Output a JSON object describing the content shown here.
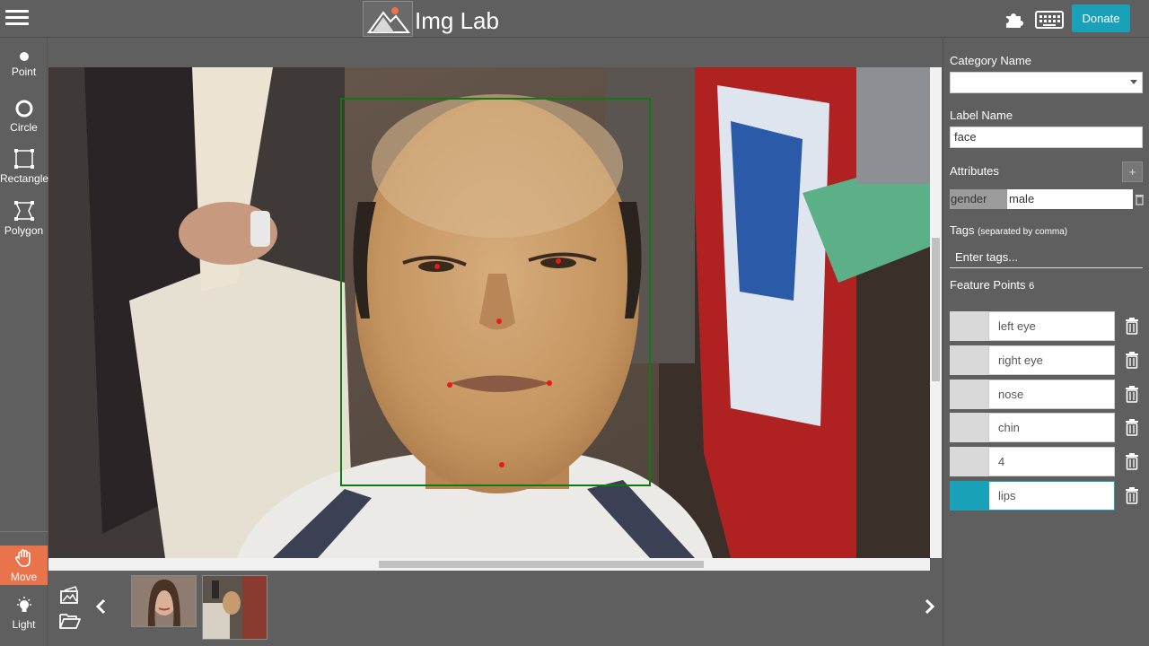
{
  "app": {
    "title": "Img Lab",
    "donate_label": "Donate"
  },
  "icons": {
    "menu": "hamburger-icon",
    "logo": "image-logo-icon",
    "plugins": "puzzle-icon",
    "shortcuts": "keyboard-icon",
    "load_images": "image-add-icon",
    "open_folder": "folder-open-icon",
    "prev": "chevron-left-icon",
    "next": "chevron-right-icon",
    "delete": "trash-icon"
  },
  "colors": {
    "accent": "#19a1b9",
    "active_tool": "#e9744c",
    "bbox": "#0f7a0f",
    "point": "#e81a1a",
    "panel": "#5f5f5f"
  },
  "tools": {
    "point": "Point",
    "circle": "Circle",
    "rectangle": "Rectangle",
    "polygon": "Polygon",
    "move": "Move",
    "light": "Light"
  },
  "panel": {
    "category_label": "Category Name",
    "category_value": "",
    "label_name_label": "Label Name",
    "label_name_value": "face",
    "attributes_label": "Attributes",
    "add_label": "+",
    "attribute_key": "gender",
    "attribute_value": "male",
    "tags_label": "Tags",
    "tags_hint": "(separated by comma)",
    "tags_placeholder": "Enter tags...",
    "feature_points_label": "Feature Points",
    "feature_points_count": "6",
    "feature_points": [
      {
        "name": "left eye",
        "color": "#d9d9d9"
      },
      {
        "name": "right eye",
        "color": "#d9d9d9"
      },
      {
        "name": "nose",
        "color": "#d9d9d9"
      },
      {
        "name": "chin",
        "color": "#d9d9d9"
      },
      {
        "name": "4",
        "color": "#d9d9d9"
      },
      {
        "name": "lips",
        "color": "#19a1b9"
      }
    ]
  }
}
